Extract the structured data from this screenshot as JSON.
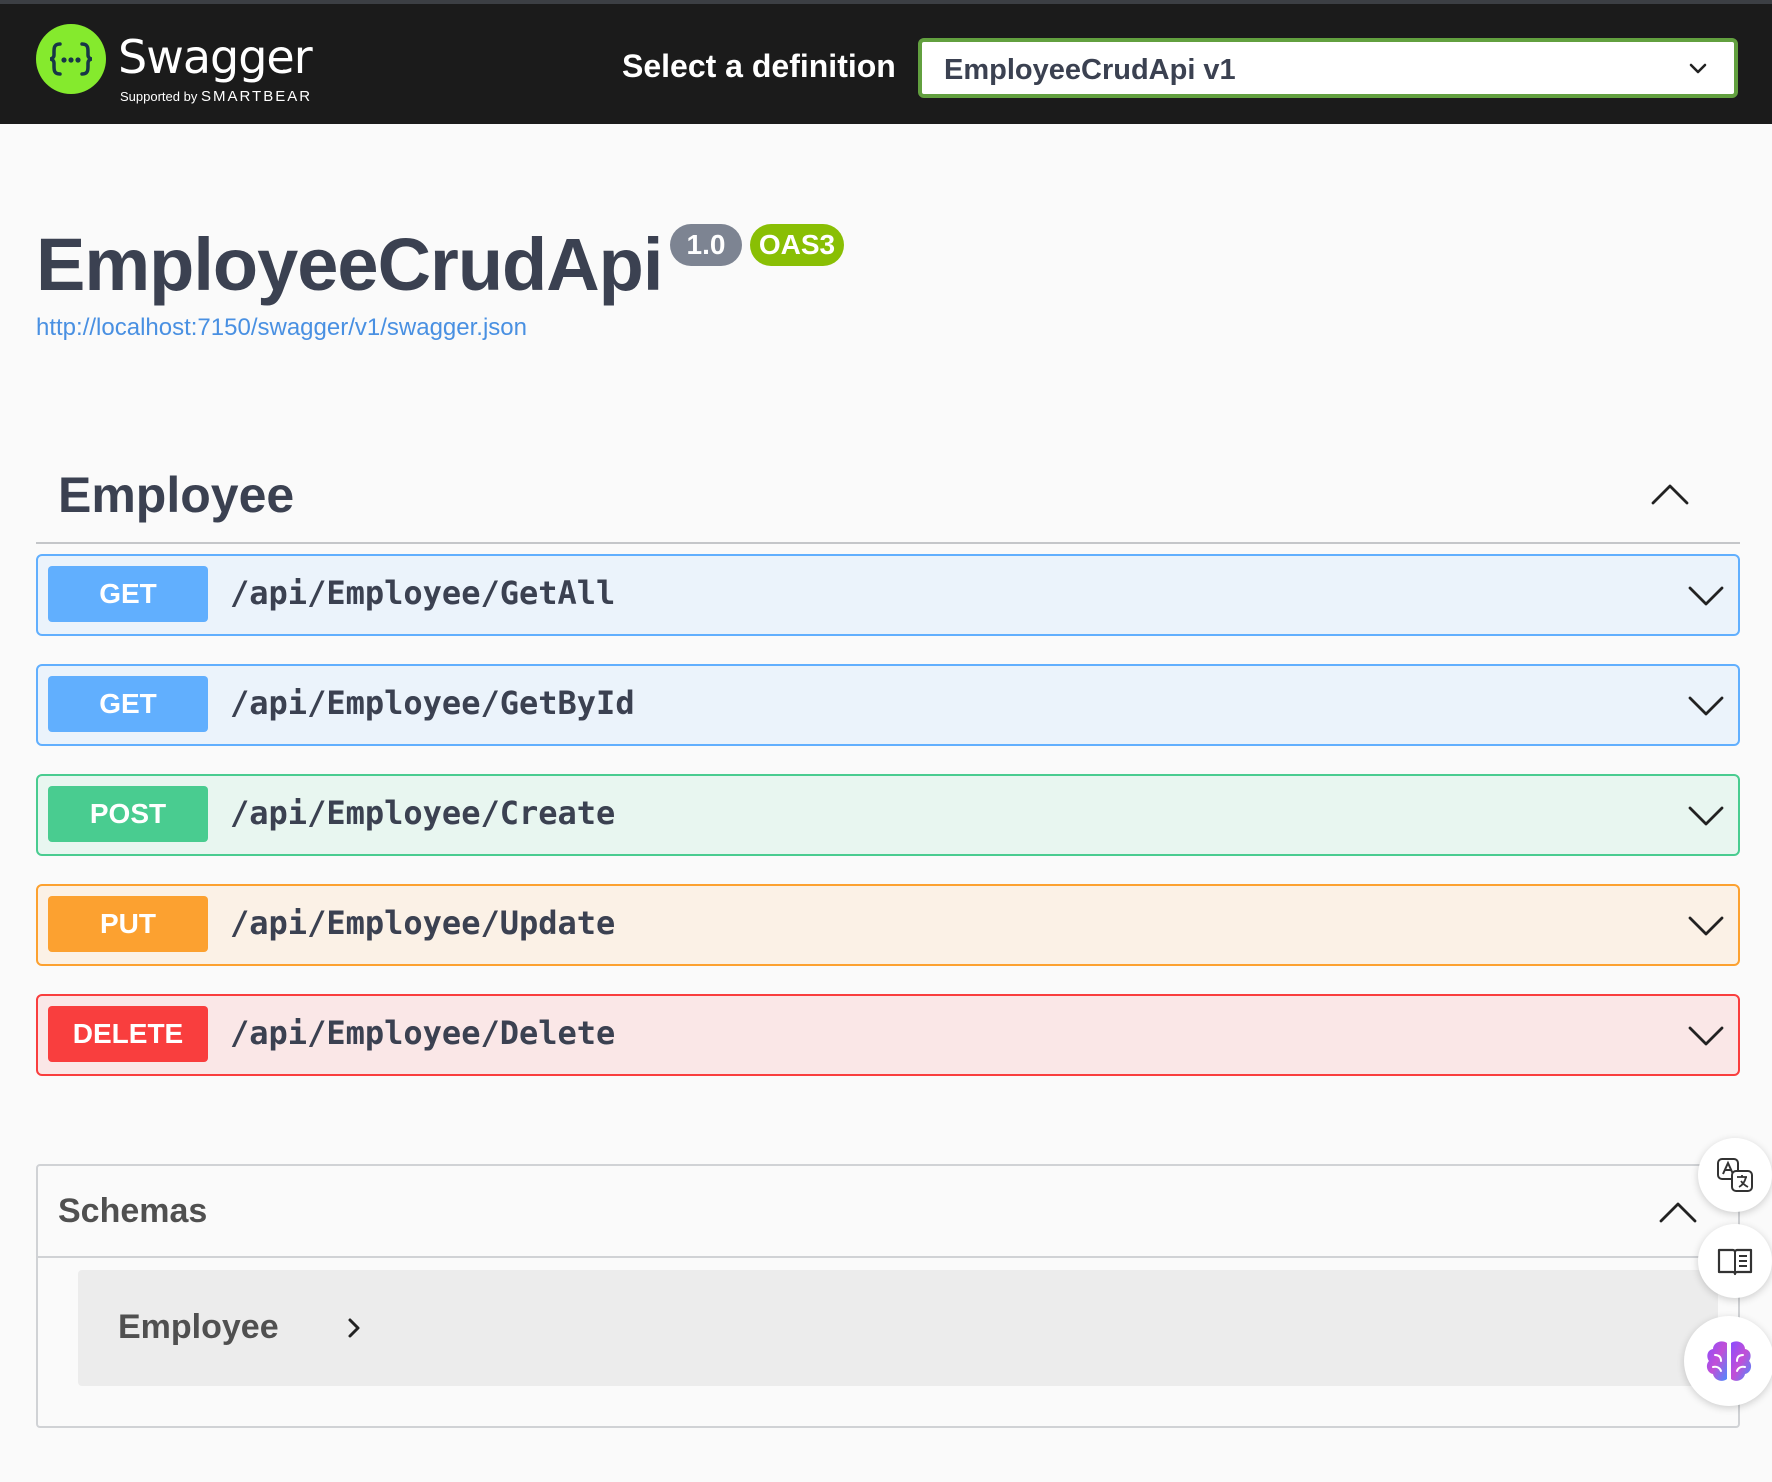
{
  "header": {
    "logo_word": "Swagger",
    "logo_tm": "™",
    "logo_sub_prefix": "Supported by",
    "logo_sub_brand": "SMARTBEAR",
    "definition_label": "Select a definition",
    "definition_selected": "EmployeeCrudApi v1"
  },
  "info": {
    "title": "EmployeeCrudApi",
    "version": "1.0",
    "oas_badge": "OAS3",
    "spec_url": "http://localhost:7150/swagger/v1/swagger.json"
  },
  "tag": {
    "name": "Employee",
    "operations": [
      {
        "method": "GET",
        "path": "/api/Employee/GetAll"
      },
      {
        "method": "GET",
        "path": "/api/Employee/GetById"
      },
      {
        "method": "POST",
        "path": "/api/Employee/Create"
      },
      {
        "method": "PUT",
        "path": "/api/Employee/Update"
      },
      {
        "method": "DELETE",
        "path": "/api/Employee/Delete"
      }
    ]
  },
  "schemas": {
    "title": "Schemas",
    "models": [
      {
        "name": "Employee"
      }
    ]
  },
  "colors": {
    "topbar": "#1b1b1b",
    "logo_green": "#85ea2d",
    "select_border": "#62a03f",
    "get": "#61affe",
    "post": "#49cc90",
    "put": "#fca130",
    "delete": "#f93e3e",
    "link": "#4990e2"
  },
  "icons": {
    "logo": "swagger-braces-icon",
    "select_caret": "chevron-down-icon",
    "section_toggle": "chevron-up-icon",
    "operation_toggle": "chevron-down-icon",
    "model_expand": "chevron-right-icon",
    "float_buttons": [
      "translate-icon",
      "reader-mode-icon",
      "brain-icon"
    ]
  }
}
